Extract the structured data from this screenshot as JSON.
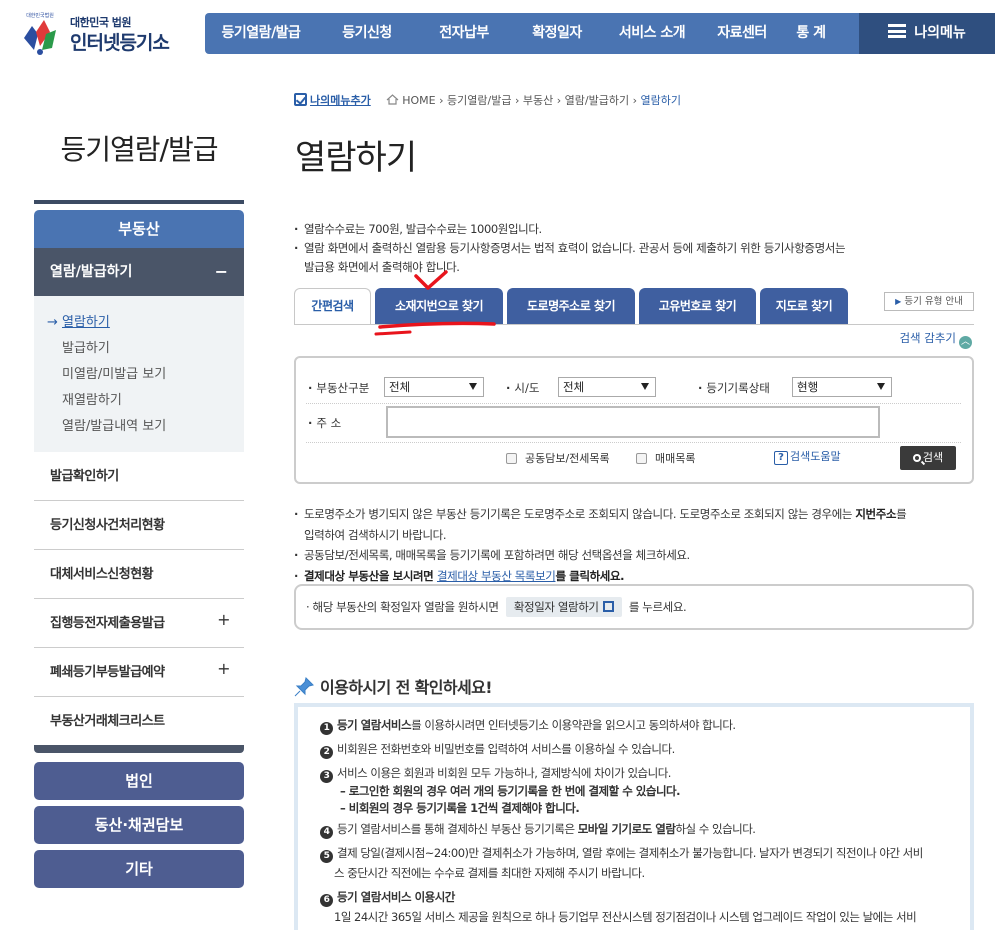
{
  "logo": {
    "emblem_text": "대한민국법원",
    "sub": "대한민국 법원",
    "main": "인터넷등기소"
  },
  "gnb": {
    "items": [
      "등기열람/발급",
      "등기신청",
      "전자납부",
      "확정일자",
      "서비스 소개",
      "자료센터",
      "통 계"
    ],
    "mymenu": "나의메뉴"
  },
  "lnb": {
    "title": "등기열람/발급",
    "head": "부동산",
    "active": "열람/발급하기",
    "active_toggle": "−",
    "sub": [
      "열람하기",
      "발급하기",
      "미열람/미발급 보기",
      "재열람하기",
      "열람/발급내역 보기"
    ],
    "current_marker": "→",
    "list": [
      {
        "label": "발급확인하기",
        "toggle": ""
      },
      {
        "label": "등기신청사건처리현황",
        "toggle": ""
      },
      {
        "label": "대체서비스신청현황",
        "toggle": ""
      },
      {
        "label": "집행등전자제출용발급",
        "toggle": "+"
      },
      {
        "label": "폐쇄등기부등발급예약",
        "toggle": "+"
      },
      {
        "label": "부동산거래체크리스트",
        "toggle": ""
      }
    ],
    "big_buttons": [
      "법인",
      "동산·채권담보",
      "기타"
    ]
  },
  "breadcrumb": {
    "addmenu": "나의메뉴추가",
    "path": [
      "HOME",
      "등기열람/발급",
      "부동산",
      "열람/발급하기"
    ],
    "current": "열람하기",
    "sep": "›"
  },
  "page_title": "열람하기",
  "notice": {
    "line1": "열람수수료는 700원, 발급수수료는 1000원입니다.",
    "line2": "열람 화면에서 출력하신 열람용 등기사항증명서는 법적 효력이 없습니다. 관공서 등에 제출하기 위한 등기사항증명서는",
    "line3": "발급용 화면에서 출력해야 합니다."
  },
  "tabs": [
    "간편검색",
    "소재지번으로 찾기",
    "도로명주소로 찾기",
    "고유번호로 찾기",
    "지도로 찾기"
  ],
  "type_guide": "등기 유형 안내",
  "type_guide_arrow": "▶",
  "hide_search": "검색 감추기",
  "hide_search_icon": "︿",
  "search": {
    "type_label": "부동산구분",
    "type_value": "전체",
    "city_label": "시/도",
    "city_value": "전체",
    "status_label": "등기기록상태",
    "status_value": "현행",
    "address_label": "주 소",
    "address_value": "",
    "check1": "공동담보/전세목록",
    "check2": "매매목록",
    "help": "검색도움말",
    "help_icon": "?",
    "button": "검색"
  },
  "notes": {
    "n1a": "도로명주소가 병기되지 않은 부동산 등기기록은 도로명주소로 조회되지 않습니다. 도로명주소로 조회되지 않는 경우에는 ",
    "n1b": "지번주소",
    "n1c": "를",
    "n1d": "입력하여 검색하시기 바랍니다.",
    "n2": "공동담보/전세목록, 매매목록을 등기기록에 포함하려면 해당 선택옵션을 체크하세요.",
    "n3a": "결제대상 부동산을 보시려면 ",
    "n3link": "결제대상 부동산 목록보기",
    "n3b": "를 클릭하세요."
  },
  "confirm": {
    "pre": "해당 부동산의 확정일자 열람을 원하시면",
    "button": "확정일자 열람하기",
    "post": "를 누르세요."
  },
  "check_title": "이용하시기 전 확인하세요!",
  "check": {
    "r1a": "등기 열람서비스",
    "r1b": "를 이용하시려면 인터넷등기소 이용약관을 읽으시고 동의하셔야 합니다.",
    "r2": "비회원은 전화번호와 비밀번호를 입력하여 서비스를 이용하실 수 있습니다.",
    "r3": "서비스 이용은 회원과 비회원 모두 가능하나, 결제방식에 차이가 있습니다.",
    "d1": "– 로그인한 회원의 경우 여러 개의 등기기록을 한 번에 결제할 수 있습니다.",
    "d2": "– 비회원의 경우 등기기록을 1건씩 결제해야 합니다.",
    "r4a": "등기 열람서비스를 통해 결제하신 부동산 등기기록은 ",
    "r4b": "모바일 기기로도 열람",
    "r4c": "하실 수 있습니다.",
    "r5a": "결제 당일(결제시점~24:00)만 결제취소가 가능하며, 열람 후에는 결제취소가 불가능합니다. 날자가 변경되기 직전이나 야간 서비",
    "r5b": "스 중단시간 직전에는 수수료 결제를 최대한 자제해 주시기 바랍니다.",
    "r6": "등기 열람서비스 이용시간",
    "r6b": "1일 24시간 365일 서비스 제공을 원칙으로 하나 등기업무 전산시스템 정기점검이나 시스템 업그레이드 작업이 있는 날에는 서비"
  },
  "nums": [
    "1",
    "2",
    "3",
    "4",
    "5",
    "6"
  ],
  "colors": {
    "primary": "#4a74b2",
    "dark": "#2f4f7f",
    "accent_text": "#2a5ea8",
    "sidebar_active": "#4a5568",
    "big_button": "#4e5d91",
    "annotation": "#e8141c"
  }
}
